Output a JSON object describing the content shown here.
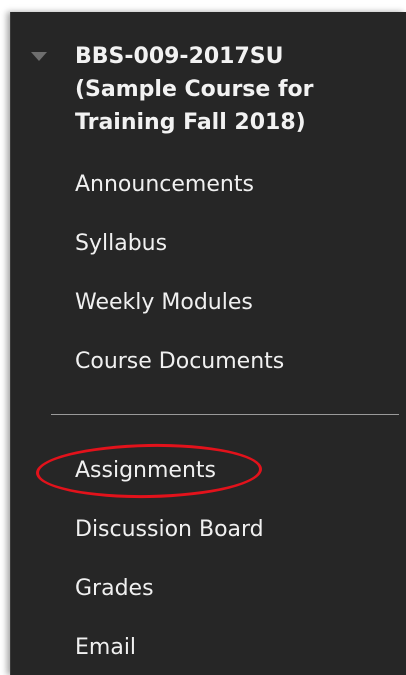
{
  "course": {
    "title": "BBS-009-2017SU (Sample Course for Training Fall 2018)"
  },
  "menu": {
    "items_top": [
      {
        "label": "Announcements"
      },
      {
        "label": "Syllabus"
      },
      {
        "label": "Weekly Modules"
      },
      {
        "label": "Course Documents"
      }
    ],
    "items_bottom": [
      {
        "label": "Assignments"
      },
      {
        "label": "Discussion Board"
      },
      {
        "label": "Grades"
      },
      {
        "label": "Email"
      }
    ]
  },
  "colors": {
    "panel_background": "#262626",
    "text": "#f0f0f0",
    "highlight": "#e2121b"
  },
  "icons": {
    "collapse": "caret-down-icon"
  }
}
